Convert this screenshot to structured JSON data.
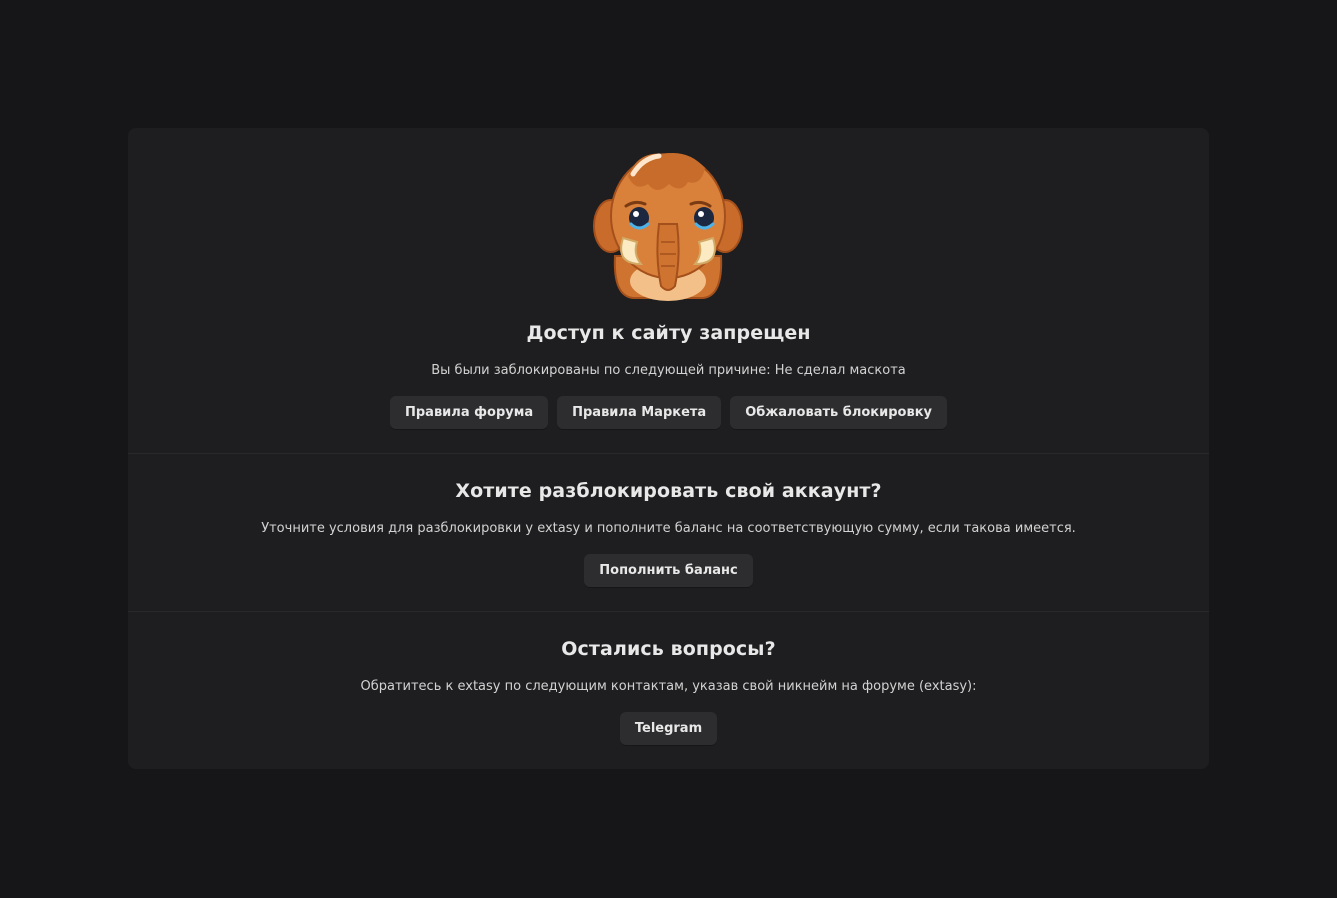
{
  "blocked": {
    "title": "Доступ к сайту запрещен",
    "reason": "Вы были заблокированы по следующей причине: Не сделал маскота",
    "buttons": {
      "forum_rules": "Правила форума",
      "market_rules": "Правила Маркета",
      "appeal": "Обжаловать блокировку"
    },
    "mascot_icon": "sad-mammoth-icon"
  },
  "unlock": {
    "title": "Хотите разблокировать свой аккаунт?",
    "text": "Уточните условия для разблокировки у extasy и пополните баланс на соответствующую сумму, если такова имеется.",
    "button": "Пополнить баланс"
  },
  "questions": {
    "title": "Остались вопросы?",
    "text": "Обратитесь к extasy по следующим контактам, указав свой никнейм на форуме (extasy):",
    "button": "Telegram"
  },
  "colors": {
    "background": "#161618",
    "card": "#1e1e20",
    "button": "#2d2d2f",
    "mascot_fur": "#d9803a"
  }
}
